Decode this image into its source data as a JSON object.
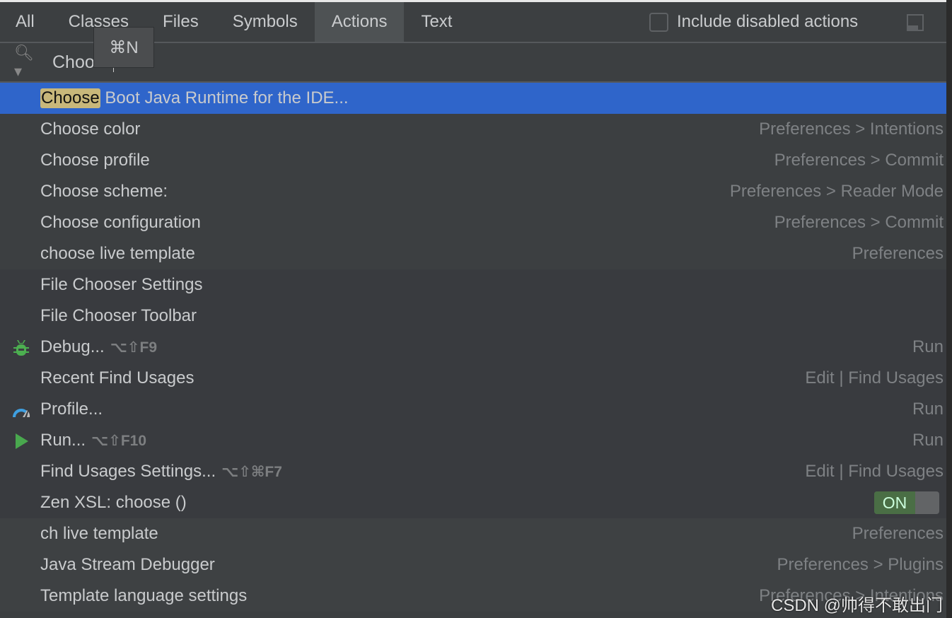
{
  "tabs": [
    {
      "label": "All"
    },
    {
      "label": "Classes"
    },
    {
      "label": "Files"
    },
    {
      "label": "Symbols"
    },
    {
      "label": "Actions",
      "active": true
    },
    {
      "label": "Text"
    }
  ],
  "include_disabled": {
    "label": "Include disabled actions",
    "checked": false
  },
  "tooltip": "⌘N",
  "search": {
    "value": "Choose"
  },
  "selected": {
    "match": "Choose",
    "rest": " Boot Java Runtime for the IDE..."
  },
  "rows": [
    {
      "label": "Choose color",
      "right": "Preferences > Intentions",
      "group": "g1"
    },
    {
      "label": "Choose profile",
      "right": "Preferences > Commit",
      "group": "g1"
    },
    {
      "label": "Choose scheme:",
      "right": "Preferences > Reader Mode",
      "group": "g1"
    },
    {
      "label": "Choose configuration",
      "right": "Preferences > Commit",
      "group": "g1"
    },
    {
      "label": "choose live template",
      "right": "Preferences",
      "group": "g1"
    },
    {
      "label": "File Chooser Settings",
      "right": "",
      "group": "g2"
    },
    {
      "label": "File Chooser Toolbar",
      "right": "",
      "group": "g2"
    },
    {
      "label": "Debug...",
      "shortcut": "⌥⇧F9",
      "right": "Run",
      "icon": "debug-bug-icon",
      "group": "g2"
    },
    {
      "label": "Recent Find Usages",
      "right": "Edit | Find Usages",
      "group": "g2"
    },
    {
      "label": "Profile...",
      "right": "Run",
      "icon": "profiler-gauge-icon",
      "group": "g2"
    },
    {
      "label": "Run...",
      "shortcut": "⌥⇧F10",
      "right": "Run",
      "icon": "run-play-icon",
      "group": "g2"
    },
    {
      "label": "Find Usages Settings...",
      "shortcut": "⌥⇧⌘F7",
      "right": "Edit | Find Usages",
      "group": "g2"
    },
    {
      "label": "Zen XSL: choose ()",
      "toggle": "ON",
      "group": "g2"
    },
    {
      "label": "ch live template",
      "right": "Preferences",
      "group": "g3"
    },
    {
      "label": "Java Stream Debugger",
      "right": "Preferences > Plugins",
      "group": "g3"
    },
    {
      "label": "Template language settings",
      "right": "Preferences > Intentions",
      "group": "g3"
    }
  ],
  "colors": {
    "selection": "#2f65ca",
    "match_highlight": "#c8b77a",
    "toggle_on": "#4a6e45"
  },
  "watermark": "CSDN @帅得不敢出门"
}
